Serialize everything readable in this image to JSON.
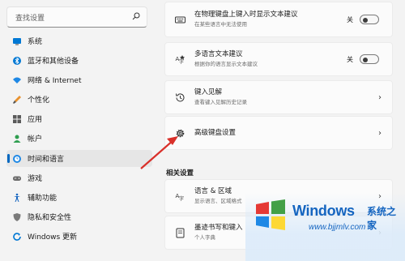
{
  "sidebar": {
    "search_placeholder": "查找设置",
    "items": [
      {
        "label": "系统",
        "icon": "monitor-icon"
      },
      {
        "label": "蓝牙和其他设备",
        "icon": "bluetooth-icon"
      },
      {
        "label": "网络 & Internet",
        "icon": "wifi-icon"
      },
      {
        "label": "个性化",
        "icon": "brush-icon"
      },
      {
        "label": "应用",
        "icon": "apps-icon"
      },
      {
        "label": "帐户",
        "icon": "account-icon"
      },
      {
        "label": "时间和语言",
        "icon": "globe-clock-icon",
        "active": true
      },
      {
        "label": "游戏",
        "icon": "gamepad-icon"
      },
      {
        "label": "辅助功能",
        "icon": "accessibility-icon"
      },
      {
        "label": "隐私和安全性",
        "icon": "shield-icon"
      },
      {
        "label": "Windows 更新",
        "icon": "update-icon"
      }
    ]
  },
  "main": {
    "cards": [
      {
        "title": "在物理键盘上键入时显示文本建议",
        "subtitle": "在某些语言中无法使用",
        "control": "toggle",
        "toggle_label": "关",
        "icon": "keyboard-icon"
      },
      {
        "title": "多语言文本建议",
        "subtitle": "根据你的语言显示文本建议",
        "control": "toggle",
        "toggle_label": "关",
        "icon": "language-suggest-icon"
      },
      {
        "title": "键入见解",
        "subtitle": "查看键入见解历史记录",
        "control": "chevron",
        "icon": "history-icon"
      },
      {
        "title": "高级键盘设置",
        "subtitle": "",
        "control": "chevron",
        "icon": "gear-icon"
      }
    ],
    "related_title": "相关设置",
    "related_cards": [
      {
        "title": "语言 & 区域",
        "subtitle": "显示语言、区域格式",
        "control": "chevron",
        "icon": "language-region-icon"
      },
      {
        "title": "墨迹书写和键入",
        "subtitle": "个人字典",
        "control": "chevron",
        "icon": "ink-icon"
      }
    ]
  },
  "watermark": {
    "brand": "Windows",
    "cn": "系统之家",
    "url": "www.bjjmlv.com"
  },
  "colors": {
    "accent": "#0067c0",
    "arrow": "#d9302a",
    "watermark": "#1565c0"
  }
}
